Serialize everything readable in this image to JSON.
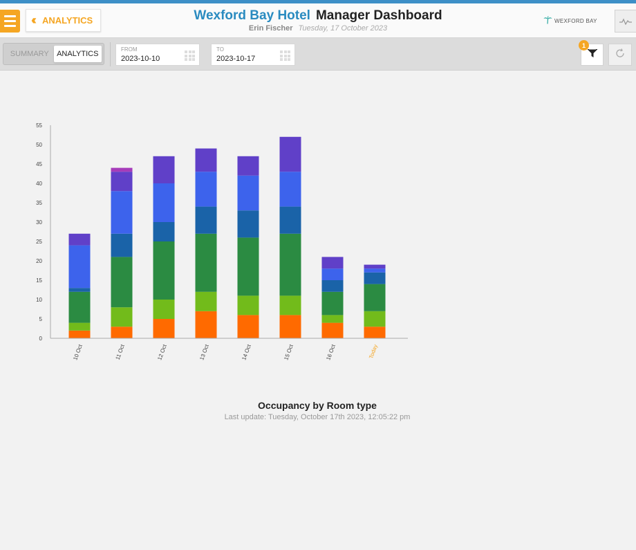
{
  "header": {
    "back_label": "ANALYTICS",
    "hotel_name": "Wexford Bay Hotel",
    "dashboard_title": "Manager Dashboard",
    "user_name": "Erin Fischer",
    "current_date": "Tuesday, 17 October 2023",
    "brand_name": "WEXFORD BAY"
  },
  "toolbar": {
    "tabs": [
      {
        "label": "SUMMARY",
        "active": false
      },
      {
        "label": "ANALYTICS",
        "active": true
      }
    ],
    "from_label": "FROM",
    "from_value": "2023-10-10",
    "to_label": "TO",
    "to_value": "2023-10-17",
    "filter_count": "1"
  },
  "icons": {
    "menu": "hamburger-menu-icon",
    "back": "double-chevron-left-icon",
    "brand": "palm-tree-icon",
    "pulse": "pulse-line-icon",
    "calendar": "calendar-grid-icon",
    "filter": "funnel-filter-icon",
    "refresh": "refresh-icon"
  },
  "colors": {
    "accent": "#f5a623",
    "hotel_title": "#2a8bc0",
    "today_tick": "#f5a623"
  },
  "chart_meta": {
    "title": "Occupancy by Room type",
    "last_update": "Last update: Tuesday, October 17th 2023, 12:05:22 pm"
  },
  "chart_data": {
    "type": "bar",
    "stacked": true,
    "categories": [
      "10 Oct",
      "11 Oct",
      "12 Oct",
      "13 Oct",
      "14 Oct",
      "15 Oct",
      "16 Oct",
      "Today"
    ],
    "highlight_category": "Today",
    "ylim": [
      0,
      55
    ],
    "yticks": [
      0,
      5,
      10,
      15,
      20,
      25,
      30,
      35,
      40,
      45,
      50,
      55
    ],
    "title": "Occupancy by Room type",
    "xlabel": "",
    "ylabel": "",
    "grid": false,
    "legend": "none",
    "series": [
      {
        "color": "#ff6a00",
        "values": [
          2,
          3,
          5,
          7,
          6,
          6,
          4,
          3
        ]
      },
      {
        "color": "#72bb1b",
        "values": [
          2,
          5,
          5,
          5,
          5,
          5,
          2,
          4
        ]
      },
      {
        "color": "#2b8b42",
        "values": [
          8,
          13,
          15,
          15,
          15,
          16,
          6,
          7
        ]
      },
      {
        "color": "#1a63a8",
        "values": [
          1,
          6,
          5,
          7,
          7,
          7,
          3,
          3
        ]
      },
      {
        "color": "#3d63ec",
        "values": [
          11,
          11,
          10,
          9,
          9,
          9,
          3,
          1
        ]
      },
      {
        "color": "#6040c8",
        "values": [
          3,
          5,
          7,
          6,
          5,
          9,
          3,
          1
        ]
      },
      {
        "color": "#a63cba",
        "values": [
          0,
          1,
          0,
          0,
          0,
          0,
          0,
          0
        ]
      }
    ]
  }
}
